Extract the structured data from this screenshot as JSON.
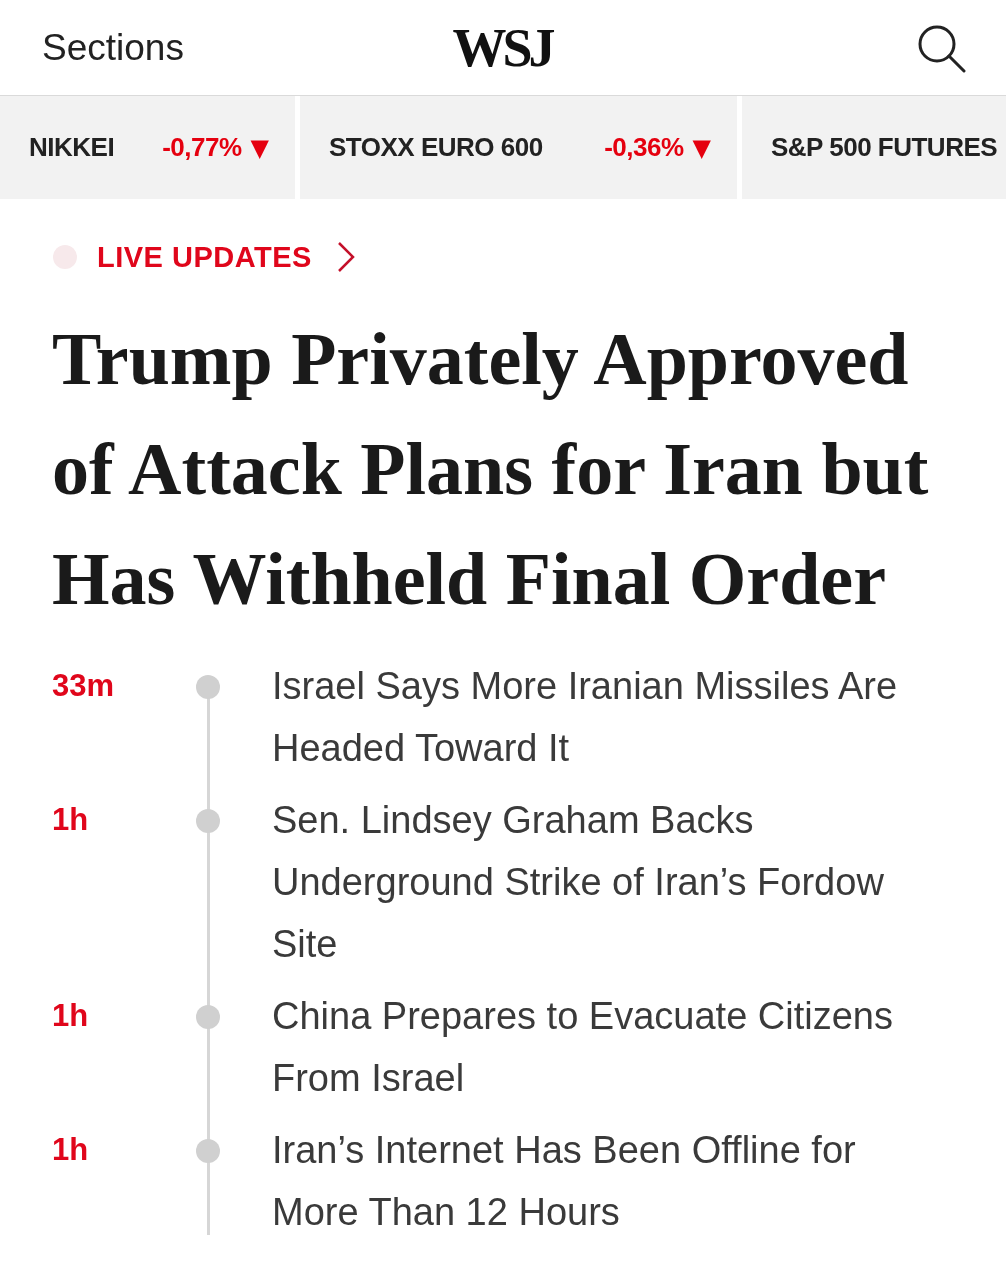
{
  "header": {
    "menu_label": "Sections",
    "logo": "WSJ"
  },
  "tickers": [
    {
      "name": "NIKKEI",
      "change": "-0,77%",
      "arrow": "▼"
    },
    {
      "name": "STOXX EURO 600",
      "change": "-0,36%",
      "arrow": "▼"
    },
    {
      "name": "S&P 500 FUTURES"
    }
  ],
  "live_link": {
    "label": "LIVE UPDATES"
  },
  "headline": "Trump Privately Approved of Attack Plans for Iran but Has Withheld Final Order",
  "updates": [
    {
      "time": "33m",
      "title": "Israel Says More Iranian Missiles Are Headed Toward It"
    },
    {
      "time": "1h",
      "title": "Sen. Lindsey Graham Backs Underground Strike of Iran’s Fordow Site"
    },
    {
      "time": "1h",
      "title": "China Prepares to Evacuate Citizens From Israel"
    },
    {
      "time": "1h",
      "title": "Iran’s Internet Has Been Offline for More Than 12 Hours"
    }
  ]
}
